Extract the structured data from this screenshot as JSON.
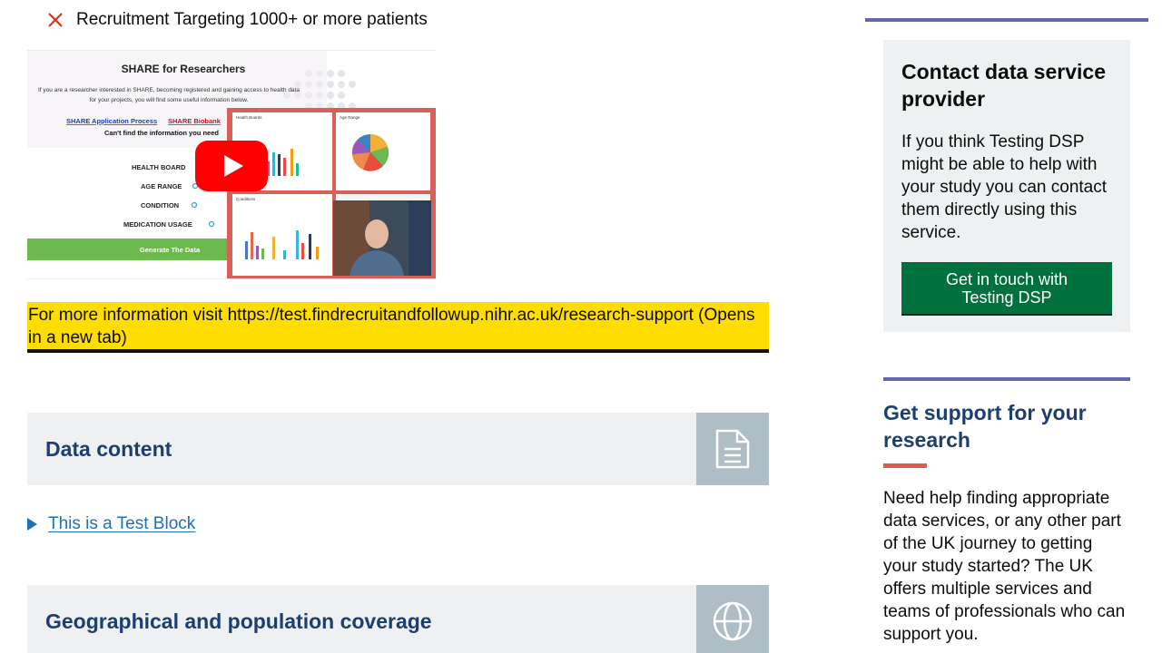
{
  "criteria": {
    "icon": "cross-icon",
    "icon_color": "#d4351c",
    "text": "Recruitment Targeting 1000+ or more patients"
  },
  "video": {
    "heading": "SHARE for Researchers",
    "intro_line1": "If you are a researcher interested in SHARE, becoming registered and gaining access to health data",
    "intro_line2": "for your projects, you will find some useful information below.",
    "link1": "SHARE Application Process",
    "link2": "SHARE Biobank",
    "cant_find": "Can't find the information you need",
    "filters": [
      "HEALTH BOARD",
      "AGE RANGE",
      "CONDITION",
      "MEDICATION USAGE"
    ],
    "generate_label": "Generate The Data",
    "panel_labels": [
      "Health Boards",
      "Age Range",
      "Conditions"
    ],
    "play_icon": "youtube-play-icon"
  },
  "info_banner": {
    "text": "For more information visit https://test.findrecruitandfollowup.nihr.ac.uk/research-support (Opens in a new tab)"
  },
  "sections": {
    "data_content": {
      "title": "Data content",
      "icon": "document-icon"
    },
    "geo": {
      "title": "Geographical and population coverage",
      "icon": "globe-icon"
    }
  },
  "details": {
    "link_text": "This is a Test Block"
  },
  "contact": {
    "title": "Contact data service provider",
    "text": "If you think Testing DSP might be able to help with your study you can contact them directly using this service.",
    "button_label": "Get in touch with Testing DSP"
  },
  "support": {
    "title": "Get support for your research",
    "text": "Need help finding appropriate data services, or any other part of the UK journey to getting your study started? The UK offers multiple services and teams of professionals who can support you."
  },
  "colors": {
    "banner": "#ffdd00",
    "button": "#00703c",
    "heading_blue": "#1d3f6e",
    "rule_purple": "#6467a8",
    "accent_red": "#e05a4e",
    "link_blue": "#1d70b8"
  }
}
